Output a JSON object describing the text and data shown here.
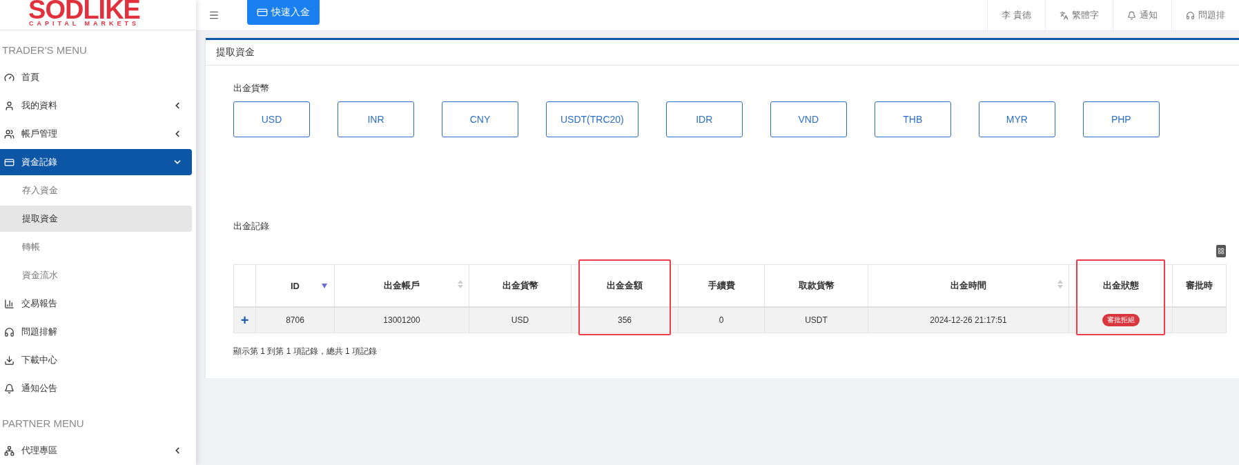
{
  "logo": {
    "name": "SODLIKE",
    "tagline": "CAPITAL MARKETS"
  },
  "sidebar": {
    "sections": [
      {
        "title": "TRADER'S MENU",
        "items": [
          {
            "label": "首頁",
            "selected": false
          },
          {
            "label": "我的資料",
            "selected": false,
            "expanded": false
          },
          {
            "label": "帳戶管理",
            "selected": false,
            "expanded": false
          },
          {
            "label": "資金記錄",
            "selected": true,
            "expanded": true,
            "children": [
              {
                "label": "存入資金",
                "selected": false
              },
              {
                "label": "提取資金",
                "selected": true
              },
              {
                "label": "轉帳",
                "selected": false
              },
              {
                "label": "資金流水",
                "selected": false
              }
            ]
          },
          {
            "label": "交易報告",
            "selected": false
          },
          {
            "label": "問題排解",
            "selected": false
          },
          {
            "label": "下載中心",
            "selected": false
          },
          {
            "label": "通知公告",
            "selected": false
          }
        ]
      },
      {
        "title": "PARTNER MENU",
        "items": [
          {
            "label": "代理專區",
            "selected": false,
            "expanded": false
          }
        ]
      }
    ]
  },
  "topbar": {
    "deposit_button": "快速入金",
    "user": "李 貴德",
    "language": "繁體字",
    "notifications": "通知",
    "help": "問題排"
  },
  "card": {
    "title": "提取資金",
    "currency_label": "出金貨幣",
    "currencies": [
      "USD",
      "INR",
      "CNY",
      "USDT(TRC20)",
      "IDR",
      "VND",
      "THB",
      "MYR",
      "PHP"
    ],
    "records_label": "出金記錄",
    "table": {
      "columns": [
        {
          "label": "ID",
          "sorted": true
        },
        {
          "label": "出金帳戶",
          "sorted": false
        },
        {
          "label": "出金貨幣"
        },
        {
          "label": "出金金額",
          "highlighted": true
        },
        {
          "label": "手續費"
        },
        {
          "label": "取款貨幣"
        },
        {
          "label": "出金時間",
          "sorted": false
        },
        {
          "label": "出金狀態",
          "highlighted": true
        },
        {
          "label": "審批時"
        }
      ],
      "rows": [
        {
          "expand": "+",
          "cells": [
            "8706",
            "13001200",
            "USD",
            "356",
            "0",
            "USDT",
            "2024-12-26 21:17:51"
          ],
          "status": {
            "text": "審批拒絕",
            "color": "#d9363e"
          }
        }
      ]
    },
    "summary": "顯示第 1 到第 1 項記錄，總共 1 項記錄"
  }
}
